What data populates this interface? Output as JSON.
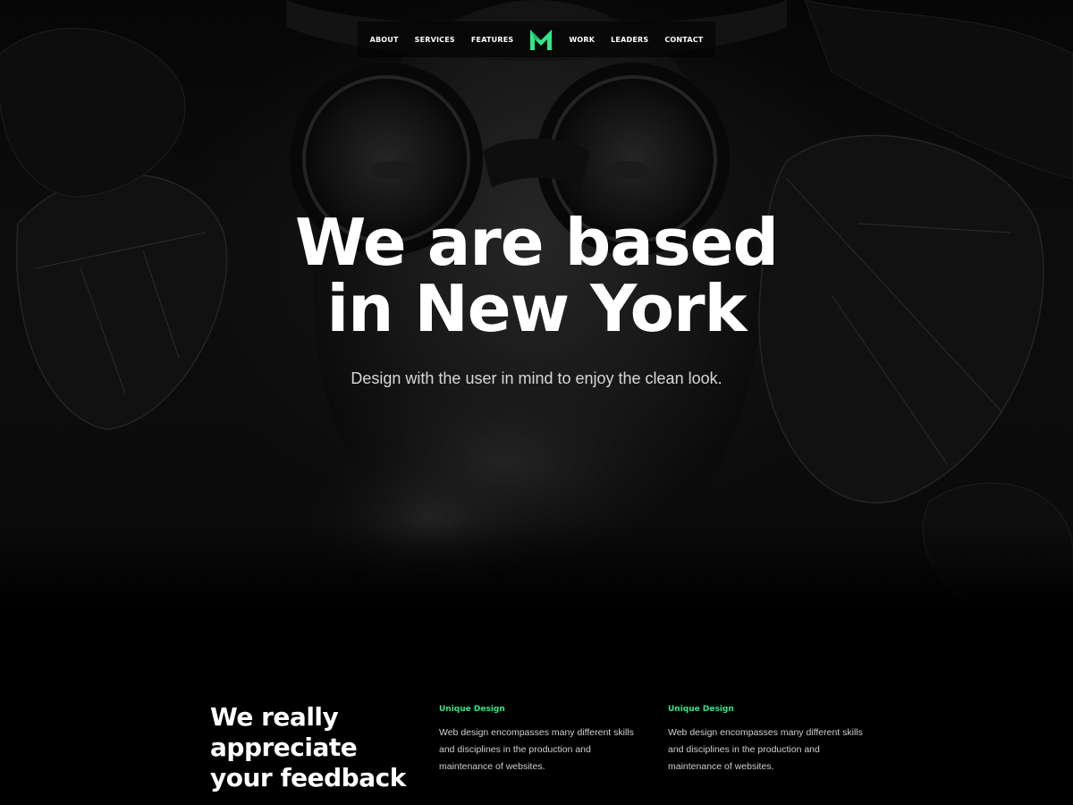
{
  "brand": {
    "logo_icon": "m-logo-icon",
    "accent_color": "#2ee88a"
  },
  "nav": {
    "items": [
      {
        "label": "ABOUT"
      },
      {
        "label": "SERVICES"
      },
      {
        "label": "FEATURES"
      },
      {
        "label": "WORK"
      },
      {
        "label": "LEADERS"
      },
      {
        "label": "CONTACT"
      }
    ]
  },
  "hero": {
    "headline_line1": "We are based",
    "headline_line2": "in New York",
    "subtitle": "Design with the user in mind to enjoy the clean look."
  },
  "features_section": {
    "title_line1": "We really",
    "title_line2": "appreciate",
    "title_line3": "your feedback",
    "items": [
      {
        "title": "Unique Design",
        "text": "Web design encompasses many different skills and disciplines in the production and maintenance of websites."
      },
      {
        "title": "Unique Design",
        "text": "Web design encompasses many different skills and disciplines in the production and maintenance of websites."
      }
    ]
  }
}
